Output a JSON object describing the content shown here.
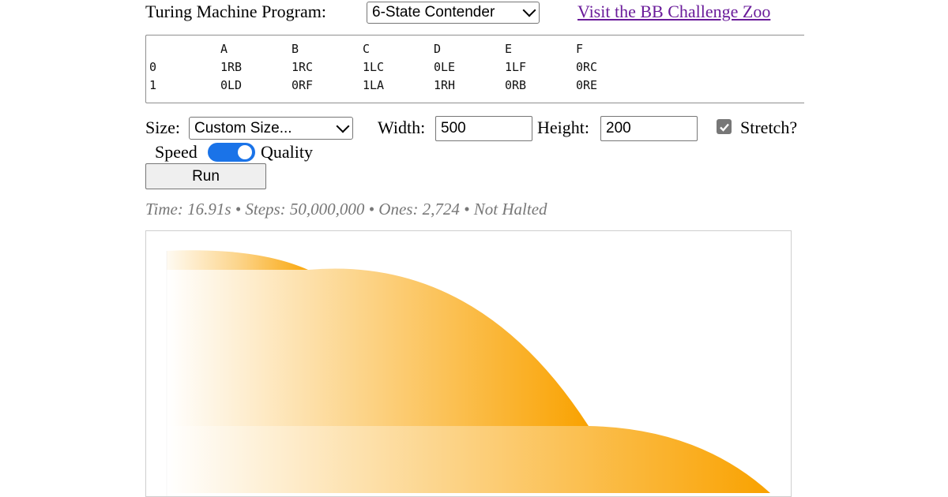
{
  "header": {
    "program_label": "Turing Machine Program:",
    "program_select": "6-State Contender",
    "zoo_link": "Visit the BB Challenge Zoo"
  },
  "program_table": {
    "columns": [
      "",
      "A",
      "B",
      "C",
      "D",
      "E",
      "F"
    ],
    "rows": [
      [
        "0",
        "1RB",
        "1RC",
        "1LC",
        "0LE",
        "1LF",
        "0RC"
      ],
      [
        "1",
        "0LD",
        "0RF",
        "1LA",
        "1RH",
        "0RB",
        "0RE"
      ]
    ]
  },
  "controls": {
    "size_label": "Size:",
    "size_select": "Custom Size...",
    "width_label": "Width:",
    "width_value": "500",
    "height_label": "Height:",
    "height_value": "200",
    "stretch_label": "Stretch?",
    "stretch_checked": true,
    "speed_label": "Speed",
    "quality_label": "Quality",
    "toggle_on": true,
    "run_label": "Run"
  },
  "status": {
    "text": "Time: 16.91s • Steps: 50,000,000 • Ones: 2,724 • Not Halted"
  },
  "colors": {
    "accent_orange": "#f9a200",
    "toggle_blue": "#1a73e8",
    "link_purple": "#6a1b9a"
  },
  "icons": {
    "select_arrow": "chevron-down-icon",
    "checkbox": "check-icon"
  }
}
